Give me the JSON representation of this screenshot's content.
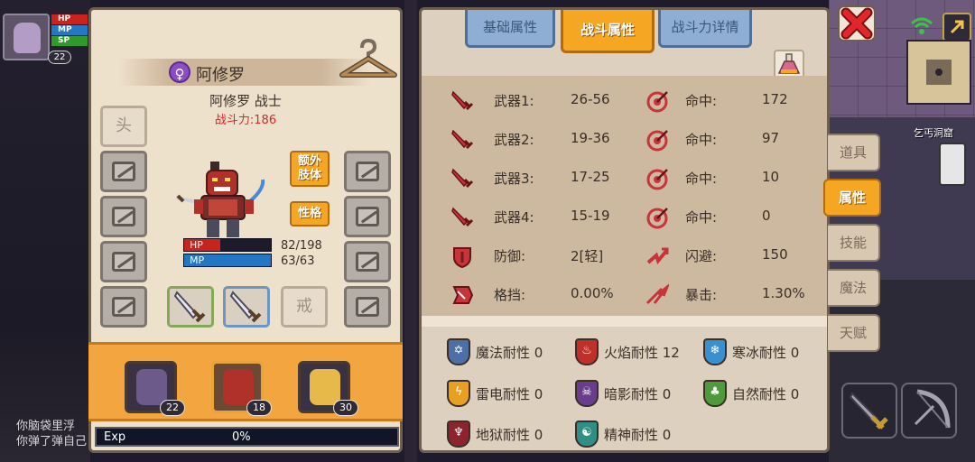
{
  "hud": {
    "level": "22",
    "bars": [
      "HP",
      "MP",
      "SP"
    ]
  },
  "chat": [
    "你脑袋里浮",
    "你弹了弹自己"
  ],
  "character": {
    "name": "阿修罗",
    "gender_symbol": "♀",
    "title": "阿修罗 战士",
    "power": "战斗力:186",
    "equip_labels": {
      "hat": "头",
      "ring": "戒"
    },
    "buttons": {
      "extra_limb": "额外\n肢体",
      "personality": "性格"
    },
    "hp": {
      "label": "HP",
      "value": "82/198",
      "fraction": 0.414
    },
    "mp": {
      "label": "MP",
      "value": "63/63",
      "fraction": 1.0
    },
    "exp": {
      "label": "Exp",
      "value": "0%"
    }
  },
  "party": [
    {
      "level": "22"
    },
    {
      "level": "18"
    },
    {
      "level": "30"
    }
  ],
  "tabs": [
    "基础属性",
    "战斗属性",
    "战斗力详情"
  ],
  "combat_stats": [
    {
      "label": "武器1:",
      "value": "26-56",
      "label2": "命中:",
      "value2": "172"
    },
    {
      "label": "武器2:",
      "value": "19-36",
      "label2": "命中:",
      "value2": "97"
    },
    {
      "label": "武器3:",
      "value": "17-25",
      "label2": "命中:",
      "value2": "10"
    },
    {
      "label": "武器4:",
      "value": "15-19",
      "label2": "命中:",
      "value2": "0"
    },
    {
      "label": "防御:",
      "value": "2[轻]",
      "label2": "闪避:",
      "value2": "150"
    },
    {
      "label": "格挡:",
      "value": "0.00%",
      "label2": "暴击:",
      "value2": "1.30%"
    }
  ],
  "resistances": [
    {
      "label": "魔法耐性 0",
      "glyph": "✡",
      "color": "#4d6fa6"
    },
    {
      "label": "火焰耐性 12",
      "glyph": "♨",
      "color": "#c0302a"
    },
    {
      "label": "寒冰耐性 0",
      "glyph": "❄",
      "color": "#3a8fd0"
    },
    {
      "label": "雷电耐性 0",
      "glyph": "ϟ",
      "color": "#e8a020"
    },
    {
      "label": "暗影耐性 0",
      "glyph": "☠",
      "color": "#6a3d8c"
    },
    {
      "label": "自然耐性 0",
      "glyph": "♣",
      "color": "#4f9a3a"
    },
    {
      "label": "地狱耐性 0",
      "glyph": "♆",
      "color": "#8c2430"
    },
    {
      "label": "精神耐性 0",
      "glyph": "☯",
      "color": "#2f8f86"
    }
  ],
  "side_menu": [
    "道具",
    "属性",
    "技能",
    "魔法",
    "天赋"
  ],
  "location": "乞丐洞窟",
  "colors": {
    "accent": "#f5a623",
    "panel": "#eee1cc",
    "hp": "#c9231e",
    "mp": "#2377c4"
  }
}
